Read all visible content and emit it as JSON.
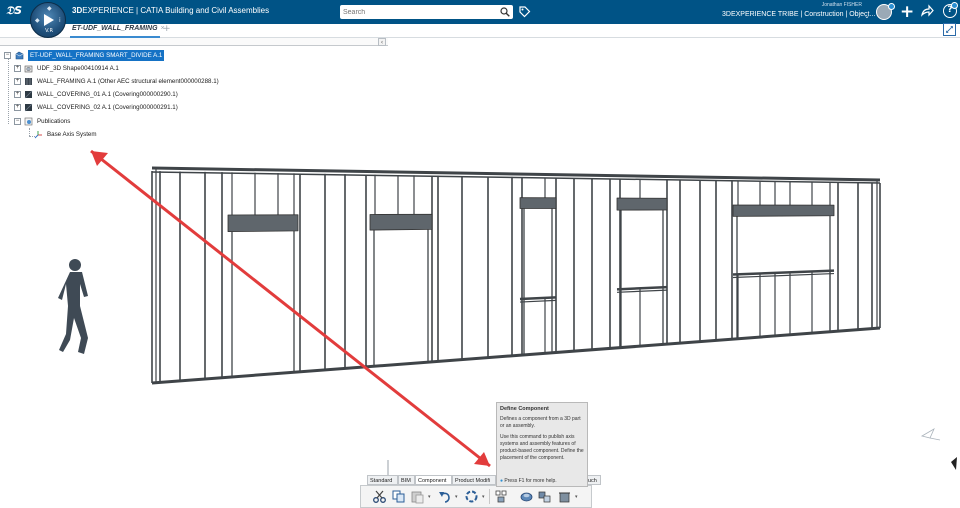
{
  "header": {
    "brand_bold": "3D",
    "brand_rest": "EXPERIENCE | CATIA Building and Civil Assemblies",
    "compass_version": "V.R",
    "search_placeholder": "Search",
    "user_name": "Jonathan FISHER",
    "tribe": "3DEXPERIENCE TRIBE | Construction | Object..."
  },
  "tabs": [
    {
      "label": "ET-UDF_WALL_FRAMING"
    }
  ],
  "tree": {
    "root": "ET-UDF_WALL_FRAMING SMART_DIVIDE A.1",
    "items": [
      {
        "label": "UDF_3D Shape00410914 A.1"
      },
      {
        "label": "WALL_FRAMING A.1 (Other AEC structural element000000288.1)"
      },
      {
        "label": "WALL_COVERING_01 A.1 (Covering000000290.1)"
      },
      {
        "label": "WALL_COVERING_02 A.1 (Covering000000291.1)"
      },
      {
        "label": "Publications"
      },
      {
        "label": "Base Axis System"
      }
    ]
  },
  "tooltip": {
    "title": "Define Component",
    "p1": "Defines a component from a 3D part or an assembly.",
    "p2": "Use this command to publish axis systems and assembly features of product-based component. Define the placement of the component.",
    "help": "Press F1 for more help."
  },
  "toolbar": {
    "tabs": [
      "Standard",
      "BIM",
      "Component",
      "Product Modifi",
      "uch"
    ],
    "active_tab": "Component"
  },
  "colors": {
    "header_bg": "#005386",
    "selection": "#1572c5",
    "arrow": "#e23c3c",
    "frame": "#555a5e"
  }
}
